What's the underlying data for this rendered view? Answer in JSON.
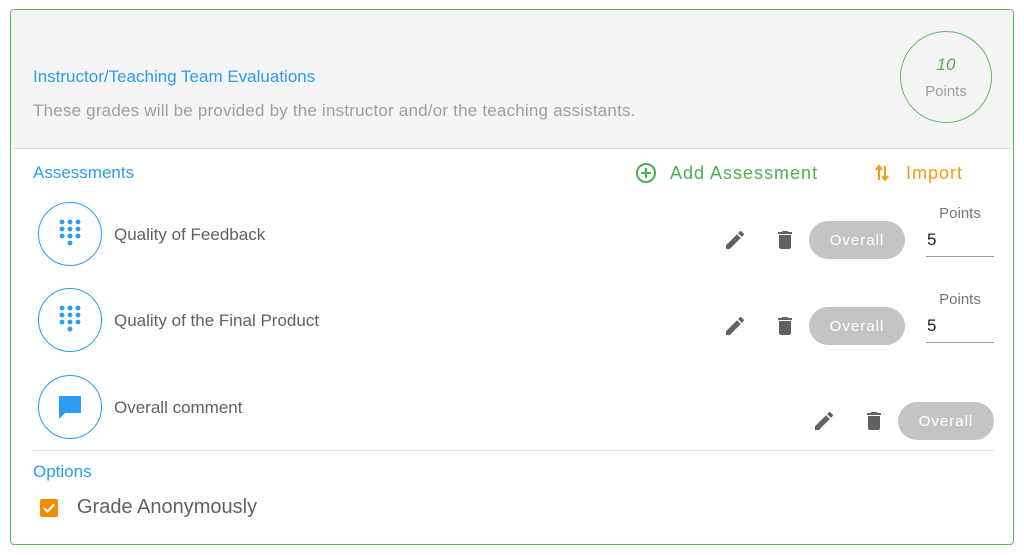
{
  "section": {
    "title": "Instructor/Teaching Team Evaluations",
    "description": "These grades will be provided by the instructor and/or the teaching assistants.",
    "points_value": "10",
    "points_label": "Points"
  },
  "assessments": {
    "title": "Assessments",
    "add_label": "Add Assessment",
    "import_label": "Import",
    "items": [
      {
        "label": "Quality of Feedback",
        "icon": "keypad-icon",
        "overall_label": "Overall",
        "points_label": "Points",
        "points_value": "5"
      },
      {
        "label": "Quality of the Final Product",
        "icon": "keypad-icon",
        "overall_label": "Overall",
        "points_label": "Points",
        "points_value": "5"
      },
      {
        "label": "Overall comment",
        "icon": "comment-icon",
        "overall_label": "Overall"
      }
    ]
  },
  "options": {
    "title": "Options",
    "grade_anonymously_label": "Grade Anonymously",
    "grade_anonymously_checked": true
  },
  "colors": {
    "accent_blue": "#2b9cf2",
    "success_green": "#4caf50",
    "import_orange": "#f39c12",
    "checkbox_orange": "#f28c00",
    "overall_gray": "#c4c4c4"
  }
}
